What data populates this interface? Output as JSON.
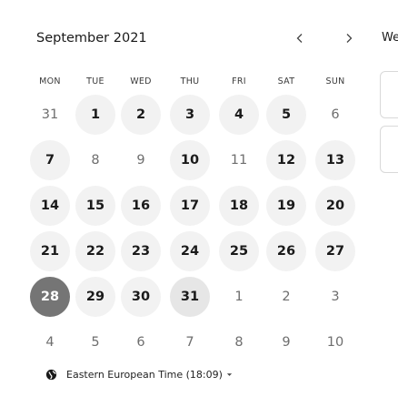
{
  "calendar": {
    "month_label": "September 2021",
    "prev_label": "‹",
    "next_label": "›",
    "weekdays": [
      "MON",
      "TUE",
      "WED",
      "THU",
      "FRI",
      "SAT",
      "SUN"
    ],
    "weeks": [
      [
        {
          "d": "31",
          "s": "unavail"
        },
        {
          "d": "1",
          "s": "avail"
        },
        {
          "d": "2",
          "s": "avail"
        },
        {
          "d": "3",
          "s": "avail"
        },
        {
          "d": "4",
          "s": "avail"
        },
        {
          "d": "5",
          "s": "avail"
        },
        {
          "d": "6",
          "s": "unavail"
        }
      ],
      [
        {
          "d": "7",
          "s": "avail"
        },
        {
          "d": "8",
          "s": "unavail"
        },
        {
          "d": "9",
          "s": "unavail"
        },
        {
          "d": "10",
          "s": "avail"
        },
        {
          "d": "11",
          "s": "unavail"
        },
        {
          "d": "12",
          "s": "avail"
        },
        {
          "d": "13",
          "s": "avail"
        }
      ],
      [
        {
          "d": "14",
          "s": "avail"
        },
        {
          "d": "15",
          "s": "avail"
        },
        {
          "d": "16",
          "s": "avail"
        },
        {
          "d": "17",
          "s": "avail"
        },
        {
          "d": "18",
          "s": "avail"
        },
        {
          "d": "19",
          "s": "avail"
        },
        {
          "d": "20",
          "s": "avail"
        }
      ],
      [
        {
          "d": "21",
          "s": "avail"
        },
        {
          "d": "22",
          "s": "avail"
        },
        {
          "d": "23",
          "s": "avail"
        },
        {
          "d": "24",
          "s": "avail"
        },
        {
          "d": "25",
          "s": "avail"
        },
        {
          "d": "26",
          "s": "avail"
        },
        {
          "d": "27",
          "s": "avail"
        }
      ],
      [
        {
          "d": "28",
          "s": "selected"
        },
        {
          "d": "29",
          "s": "avail"
        },
        {
          "d": "30",
          "s": "avail"
        },
        {
          "d": "31",
          "s": "today"
        },
        {
          "d": "1",
          "s": "unavail"
        },
        {
          "d": "2",
          "s": "unavail"
        },
        {
          "d": "3",
          "s": "unavail"
        }
      ],
      [
        {
          "d": "4",
          "s": "unavail"
        },
        {
          "d": "5",
          "s": "unavail"
        },
        {
          "d": "6",
          "s": "unavail"
        },
        {
          "d": "7",
          "s": "unavail"
        },
        {
          "d": "8",
          "s": "unavail"
        },
        {
          "d": "9",
          "s": "unavail"
        },
        {
          "d": "10",
          "s": "unavail"
        }
      ]
    ]
  },
  "timezone": {
    "label": "Eastern European Time (18:09)",
    "icon": "globe-icon"
  },
  "side_panel": {
    "label": "We"
  },
  "colors": {
    "selected_bg": "#757575",
    "available_bg": "#f2f2f2"
  }
}
